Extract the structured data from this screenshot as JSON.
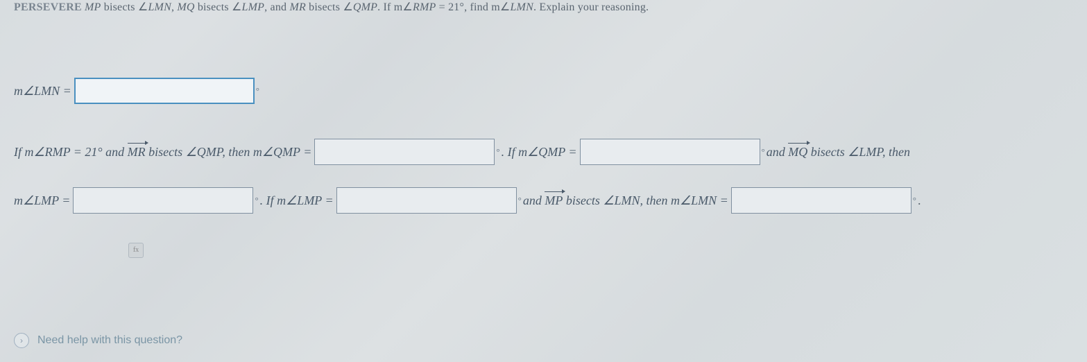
{
  "question": {
    "persevere_label": "PERSEVERE",
    "part1": " ",
    "ray1": "MP",
    "part2": " bisects ∠",
    "ang1": "LMN",
    "part3": ", ",
    "ray2": "MQ",
    "part4": " bisects ∠",
    "ang2": "LMP",
    "part5": ", and ",
    "ray3": "MR",
    "part6": " bisects ∠",
    "ang3": "QMP",
    "part7": ". If m∠",
    "ang4": "RMP",
    "part8": " = 21°, find m∠",
    "ang5": "LMN",
    "part9": ". Explain your reasoning."
  },
  "answer": {
    "line1_label": "m∠LMN =",
    "line2": {
      "p1": "If m∠RMP = 21° and ",
      "ray1": "MR",
      "p2": " bisects ∠QMP, then m∠QMP =",
      "p3": ". If m∠QMP =",
      "p4": " and ",
      "ray2": "MQ",
      "p5": " bisects ∠LMP, then"
    },
    "line3": {
      "p1": "m∠LMP =",
      "p2": ". If m∠LMP =",
      "p3": " and ",
      "ray1": "MP",
      "p4": " bisects ∠LMN, then m∠LMN ="
    }
  },
  "help": {
    "icon": "›",
    "text": "Need help with this question?"
  },
  "inputs": {
    "main": "",
    "qmp1": "",
    "qmp2": "",
    "lmp1": "",
    "lmp2": "",
    "lmn": ""
  }
}
